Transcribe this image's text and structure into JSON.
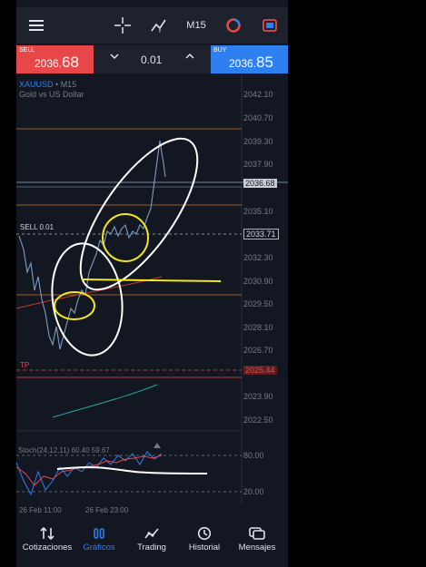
{
  "toolbar": {
    "timeframe": "M15"
  },
  "trade": {
    "sell_label": "SELL",
    "sell_price_main": "2036.",
    "sell_price_big": "68",
    "buy_label": "BUY",
    "buy_price_main": "2036.",
    "buy_price_big": "85",
    "quantity": "0.01"
  },
  "chart": {
    "symbol": "XAUUSD",
    "timeframe": "M15",
    "description": "Gold vs US Dollar",
    "sell_line_label": "SELL 0.01",
    "tp_label": "TP",
    "price_labels": [
      "2042.10",
      "2040.70",
      "2039.30",
      "2037.90",
      "2035.10",
      "2032.30",
      "2030.90",
      "2029.50",
      "2028.10",
      "2026.70",
      "2023.90",
      "2022.50"
    ],
    "bid_tag": "2036.68",
    "sell_tag": "2033.71",
    "tp_tag": "2025.44",
    "stoch_label": "Stoch(24,12,11) 60.40 59.67",
    "stoch_levels": [
      "80.00",
      "20.00"
    ],
    "x_labels": [
      "26 Feb 11:00",
      "26 Feb 23:00"
    ],
    "colors": {
      "sell": "#e8474a",
      "buy": "#2e7ff0",
      "bg": "#131722",
      "annotation_yellow": "#f5e71c"
    }
  },
  "nav": [
    {
      "label": "Cotizaciones",
      "icon": "quotes-icon",
      "active": false
    },
    {
      "label": "Gráficos",
      "icon": "charts-icon",
      "active": true
    },
    {
      "label": "Trading",
      "icon": "trading-icon",
      "active": false
    },
    {
      "label": "Historial",
      "icon": "history-icon",
      "active": false
    },
    {
      "label": "Mensajes",
      "icon": "messages-icon",
      "active": false
    }
  ]
}
